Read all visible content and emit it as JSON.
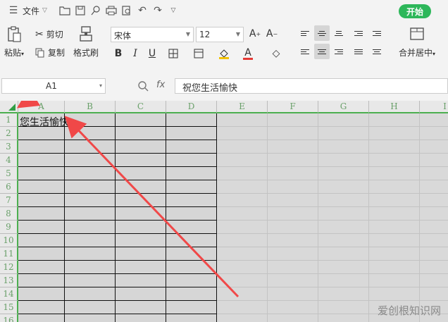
{
  "menu": {
    "file_label": "文件",
    "start_button": "开始"
  },
  "ribbon": {
    "paste_label": "粘贴",
    "cut_label": "剪切",
    "copy_label": "复制",
    "format_painter_label": "格式刷",
    "font_name": "宋体",
    "font_size": "12",
    "bold": "B",
    "italic": "I",
    "underline": "U",
    "font_color": "A",
    "merge_center_label": "合并居中"
  },
  "formula_bar": {
    "name_box": "A1",
    "fx_label": "fx",
    "content": "祝您生活愉快"
  },
  "sheet": {
    "columns": [
      "A",
      "B",
      "C",
      "D",
      "E",
      "F",
      "G",
      "H",
      "I"
    ],
    "rows": [
      "1",
      "2",
      "3",
      "4",
      "5",
      "6",
      "7",
      "8",
      "9",
      "10",
      "11",
      "12",
      "13",
      "14",
      "15",
      "16"
    ],
    "cell_a1": "您生活愉快",
    "header_color": "#4caf50",
    "arrow_color": "#f04848"
  },
  "watermark": "爱创根知识网"
}
